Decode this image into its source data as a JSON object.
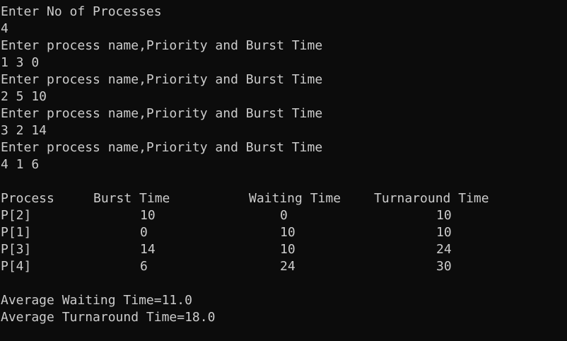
{
  "colors": {
    "background": "#0c0c0c",
    "text": "#cccccc"
  },
  "input": [
    "Enter No of Processes",
    "4",
    "Enter process name,Priority and Burst Time",
    "1 3 0",
    "Enter process name,Priority and Burst Time",
    "2 5 10",
    "Enter process name,Priority and Burst Time",
    "3 2 14",
    "Enter process name,Priority and Burst Time",
    "4 1 6"
  ],
  "table": {
    "headers": [
      "Process",
      "Burst Time",
      "Waiting Time",
      "Turnaround Time"
    ],
    "rows": [
      [
        "P[2]",
        "10",
        "0",
        "10"
      ],
      [
        "P[1]",
        "0",
        "10",
        "10"
      ],
      [
        "P[3]",
        "14",
        "10",
        "24"
      ],
      [
        "P[4]",
        "6",
        "24",
        "30"
      ]
    ]
  },
  "summary": {
    "avg_waiting": "Average Waiting Time=11.0",
    "avg_turnaround": "Average Turnaround Time=18.0"
  }
}
